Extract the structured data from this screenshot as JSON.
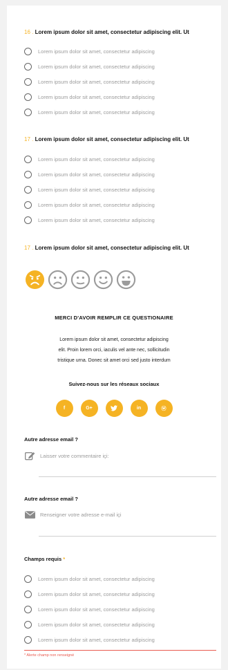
{
  "q16": {
    "number": "16",
    "sep": ".",
    "title": "Lorem ipsum dolor sit amet, consectetur adipiscing elit. Ut",
    "options": [
      "Lorem ipsum dolor sit amet, consectetur adipiscing",
      "Lorem ipsum dolor sit amet, consectetur adipiscing",
      "Lorem ipsum dolor sit amet, consectetur adipiscing",
      "Lorem ipsum dolor sit amet, consectetur adipiscing",
      "Lorem ipsum dolor sit amet, consectetur adipiscing"
    ]
  },
  "q17": {
    "number": "17",
    "sep": ".",
    "title": "Lorem ipsum dolor sit amet, consectetur adipiscing elit. Ut",
    "options": [
      "Lorem ipsum dolor sit amet, consectetur adipiscing",
      "Lorem ipsum dolor sit amet, consectetur adipiscing",
      "Lorem ipsum dolor sit amet, consectetur adipiscing",
      "Lorem ipsum dolor sit amet, consectetur adipiscing",
      "Lorem ipsum dolor sit amet, consectetur adipiscing"
    ]
  },
  "q17b": {
    "number": "17",
    "sep": ".",
    "title": "Lorem ipsum dolor sit amet, consectetur adipiscing elit. Ut",
    "smileys": [
      "very-unhappy-icon",
      "sad-icon",
      "neutral-icon",
      "happy-icon",
      "very-happy-icon"
    ],
    "selected_index": 0
  },
  "thanks": {
    "title": "MERCI D'AVOIR REMPLIR CE QUESTIONAIRE",
    "lines": [
      "Lorem ipsum dolor sit amet, consectetur adipiscing",
      "elit. Proin lorem orci, iaculis vel ante nec, sollicitudin",
      "tristique urna. Donec sit amet orci sed justo interdum"
    ]
  },
  "social": {
    "title": "Suivez-nous sur les réseaux sociaux",
    "items": [
      {
        "icon": "facebook-icon",
        "glyph": "f"
      },
      {
        "icon": "google-plus-icon",
        "glyph": "G+"
      },
      {
        "icon": "twitter-icon",
        "glyph": "t"
      },
      {
        "icon": "linkedin-icon",
        "glyph": "in"
      },
      {
        "icon": "weibo-icon",
        "glyph": "ⓦ"
      }
    ]
  },
  "comment": {
    "title": "Autre adresse email ?",
    "placeholder": "Laisser votre commentaire içi:"
  },
  "email": {
    "title": "Autre adresse email ?",
    "placeholder": "Renseigner votre adresse e-mail içi"
  },
  "required": {
    "title": "Champs requis",
    "marker": "*",
    "options": [
      "Lorem ipsum dolor sit amet, consectetur adipiscing",
      "Lorem ipsum dolor sit amet, consectetur adipiscing",
      "Lorem ipsum dolor sit amet, consectetur adipiscing",
      "Lorem ipsum dolor sit amet, consectetur adipiscing",
      "Lorem ipsum dolor sit amet, consectetur adipiscing"
    ],
    "error": "* Alerte champ non renseigné"
  },
  "colors": {
    "accent": "#f5b324",
    "error": "#e85a4f",
    "muted_text": "#9a9a9a"
  }
}
